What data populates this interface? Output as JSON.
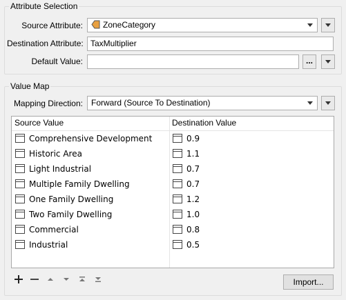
{
  "attribute_selection": {
    "title": "Attribute Selection",
    "source_label": "Source Attribute:",
    "source_value": "ZoneCategory",
    "destination_label": "Destination Attribute:",
    "destination_value": "TaxMultiplier",
    "default_label": "Default Value:",
    "default_value": "",
    "ellipsis_label": "..."
  },
  "value_map": {
    "title": "Value Map",
    "direction_label": "Mapping Direction:",
    "direction_value": "Forward (Source To Destination)",
    "columns": [
      "Source Value",
      "Destination Value"
    ],
    "rows": [
      {
        "source": "Comprehensive Development",
        "dest": "0.9"
      },
      {
        "source": "Historic Area",
        "dest": "1.1"
      },
      {
        "source": "Light Industrial",
        "dest": "0.7"
      },
      {
        "source": "Multiple Family Dwelling",
        "dest": "0.7"
      },
      {
        "source": "One Family Dwelling",
        "dest": "1.2"
      },
      {
        "source": "Two Family Dwelling",
        "dest": "1.0"
      },
      {
        "source": "Commercial",
        "dest": "0.8"
      },
      {
        "source": "Industrial",
        "dest": "0.5"
      }
    ],
    "import_label": "Import..."
  },
  "icons": {
    "attribute": "attribute-tag-icon",
    "cell": "text-field-icon",
    "add": "plus-icon",
    "remove": "minus-icon",
    "up": "move-up-icon",
    "down": "move-down-icon",
    "top": "move-top-icon",
    "bottom": "move-bottom-icon"
  }
}
